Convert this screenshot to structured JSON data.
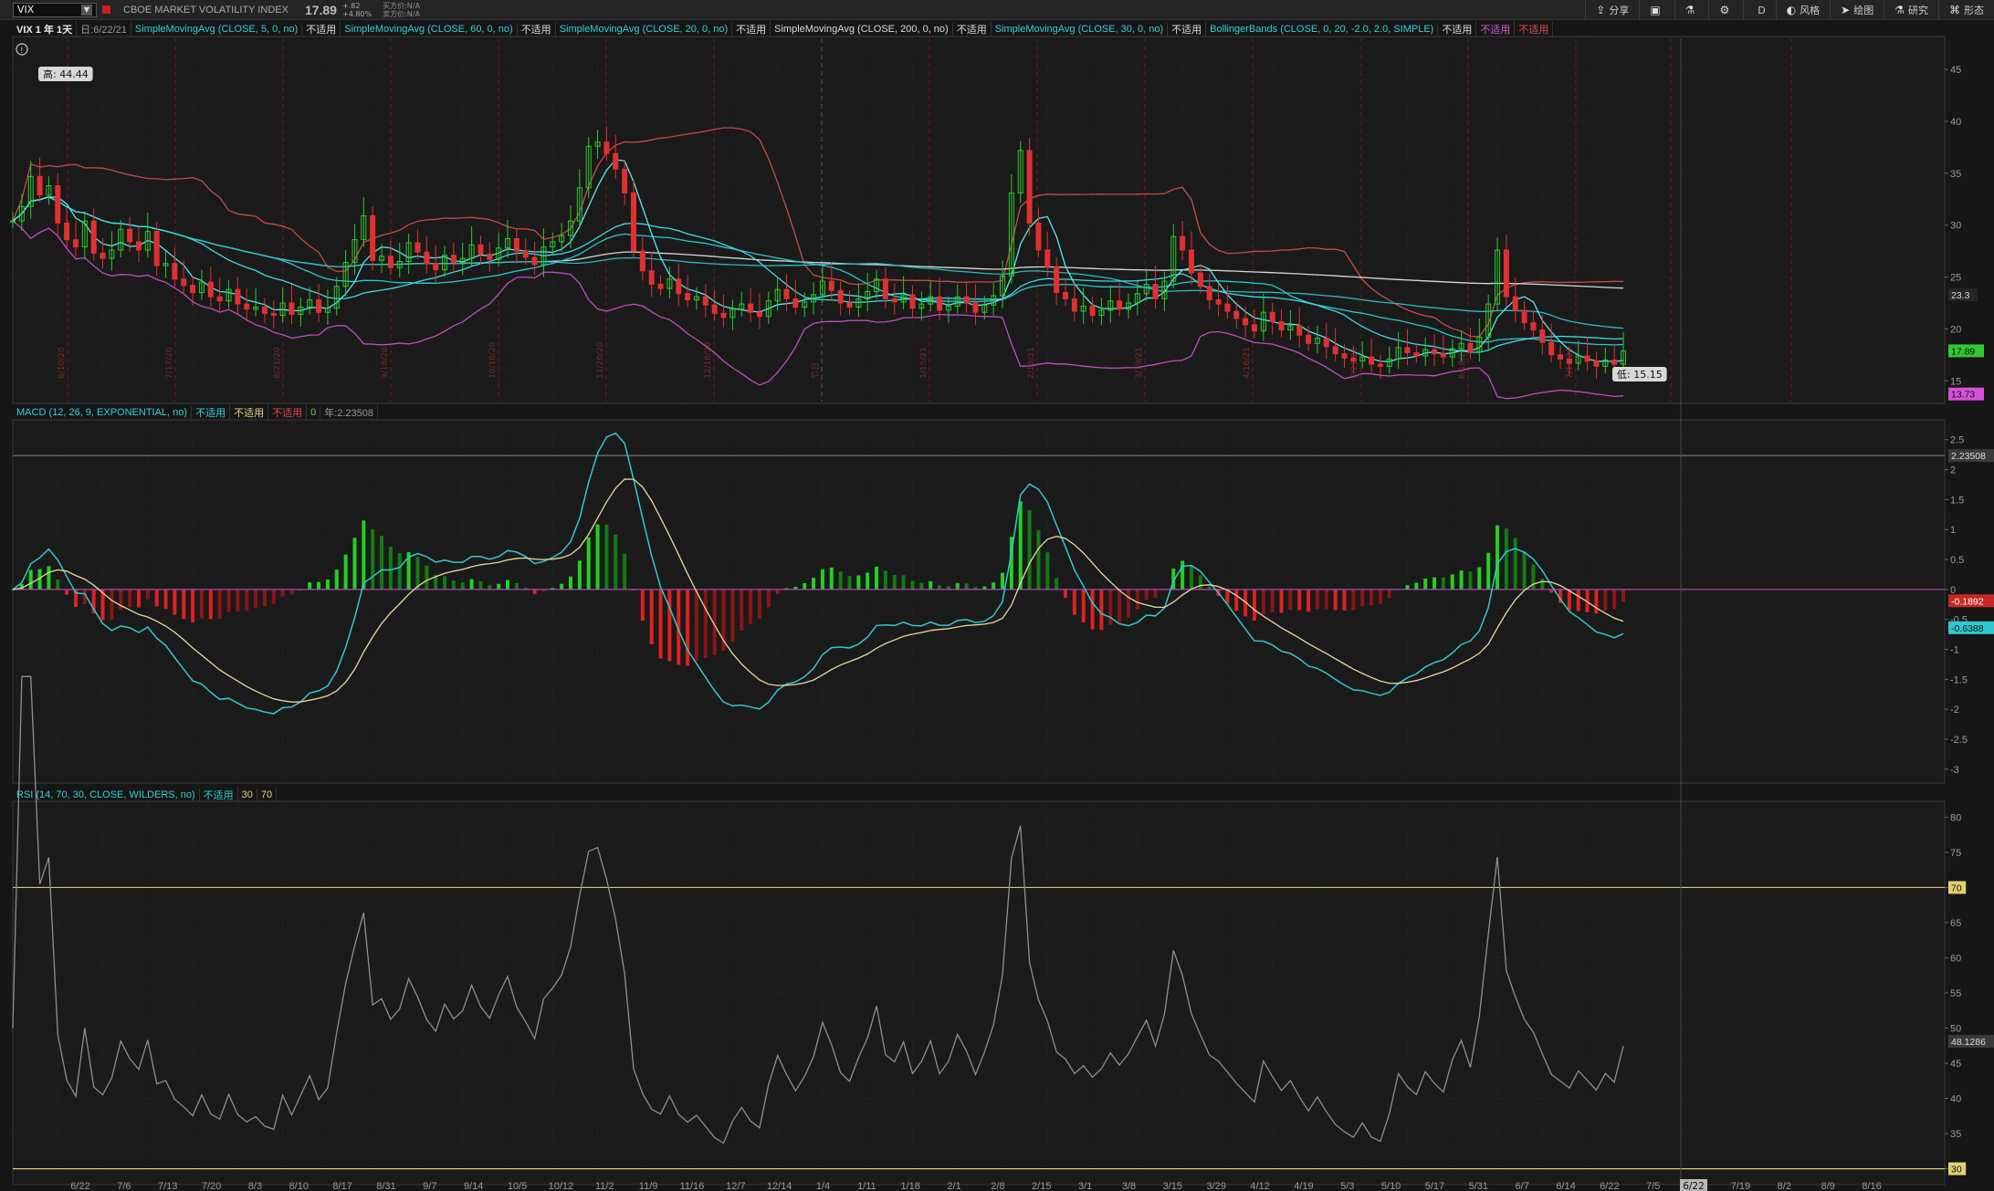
{
  "toolbar": {
    "symbol": "VIX",
    "instrument_title": "CBOE MARKET VOLATILITY INDEX",
    "last_price": "17.89",
    "change_abs": "+.82",
    "change_pct": "+4.80%",
    "bid_label": "买方价:N/A",
    "ask_label": "卖方价:N/A",
    "tools": [
      {
        "icon": "share-icon",
        "label": "分享"
      },
      {
        "icon": "layout-icon",
        "label": ""
      },
      {
        "icon": "flask-icon",
        "label": ""
      },
      {
        "icon": "gear-icon",
        "label": ""
      },
      {
        "icon": "d-label",
        "label": "D"
      },
      {
        "icon": "style-icon",
        "label": "风格"
      },
      {
        "icon": "cursor-icon",
        "label": "绘图"
      },
      {
        "icon": "study-icon",
        "label": "研究"
      },
      {
        "icon": "pattern-icon",
        "label": "形态"
      }
    ]
  },
  "price_panel": {
    "header_items": [
      {
        "text": "VIX 1 年 1天",
        "cls": "c-w"
      },
      {
        "text": "日:6/22/21",
        "cls": "c-g"
      },
      {
        "text": "SimpleMovingAvg (CLOSE, 5, 0, no)",
        "cls": "c-cy"
      },
      {
        "text": "不适用",
        "cls": "c-wh"
      },
      {
        "text": "SimpleMovingAvg (CLOSE, 60, 0, no)",
        "cls": "c-cy"
      },
      {
        "text": "不适用",
        "cls": "c-wh"
      },
      {
        "text": "SimpleMovingAvg (CLOSE, 20, 0, no)",
        "cls": "c-cy"
      },
      {
        "text": "不适用",
        "cls": "c-wh"
      },
      {
        "text": "SimpleMovingAvg (CLOSE, 200, 0, no)",
        "cls": "c-wh"
      },
      {
        "text": "不适用",
        "cls": "c-wh"
      },
      {
        "text": "SimpleMovingAvg (CLOSE, 30, 0, no)",
        "cls": "c-cy"
      },
      {
        "text": "不适用",
        "cls": "c-wh"
      },
      {
        "text": "BollingerBands (CLOSE, 0, 20, -2.0, 2.0, SIMPLE)",
        "cls": "c-cy"
      },
      {
        "text": "不适用",
        "cls": "c-wh"
      },
      {
        "text": "不适用",
        "cls": "c-mg"
      },
      {
        "text": "不适用",
        "cls": "c-r"
      }
    ],
    "high_label": "高: 44.44",
    "low_label": "低: 15.15",
    "axis_ticks": [
      "45",
      "40",
      "35",
      "30",
      "25",
      "20",
      "15"
    ],
    "badges": [
      {
        "text": "23.3",
        "color": "#dcdcdc",
        "bg": "#262626"
      },
      {
        "text": "17.89",
        "color": "#101010",
        "bg": "#32c832"
      },
      {
        "text": "13.73",
        "color": "#101010",
        "bg": "#d850d8"
      }
    ],
    "event_labels": [
      "6/10/20",
      "7/17/20",
      "8/21/20",
      "9/18/20",
      "10/16/20",
      "11/20/20",
      "12/18/20",
      "节日",
      "1/15/21",
      "2/19/21",
      "3/19/21",
      "4/16/21",
      "5/21/21",
      "6/18/21",
      "7/16/21"
    ]
  },
  "macd_panel": {
    "header_items": [
      {
        "text": "MACD (12, 26, 9, EXPONENTIAL, no)",
        "cls": "c-cy"
      },
      {
        "text": "不适用",
        "cls": "c-cy"
      },
      {
        "text": "不适用",
        "cls": "c-y"
      },
      {
        "text": "不适用",
        "cls": "c-r"
      },
      {
        "text": "0",
        "cls": "c-gr"
      },
      {
        "text": "年:2.23508",
        "cls": "c-g"
      }
    ],
    "axis_ticks": [
      "2.5",
      "2",
      "1.5",
      "1",
      "0.5",
      "0",
      "-0.5",
      "-1",
      "-1.5",
      "-2",
      "-2.5",
      "-3"
    ],
    "badges": [
      {
        "text": "2.23508",
        "color": "#dcdcdc",
        "bg": "#3a3a3a"
      },
      {
        "text": "-0.1892",
        "color": "#ffffff",
        "bg": "#c82828"
      },
      {
        "text": "-0.6388",
        "color": "#101010",
        "bg": "#30c8d0"
      }
    ]
  },
  "rsi_panel": {
    "header_items": [
      {
        "text": "RSI (14, 70, 30, CLOSE, WILDERS, no)",
        "cls": "c-cy"
      },
      {
        "text": "不适用",
        "cls": "c-cy"
      },
      {
        "text": "30",
        "cls": "c-y"
      },
      {
        "text": "70",
        "cls": "c-y"
      }
    ],
    "axis_ticks": [
      "80",
      "75",
      "70",
      "65",
      "60",
      "55",
      "50",
      "45",
      "40",
      "35",
      "30"
    ],
    "badges": [
      {
        "text": "70",
        "color": "#101010",
        "bg": "#e0d070"
      },
      {
        "text": "48.1286",
        "color": "#dcdcdc",
        "bg": "#3a3a3a"
      },
      {
        "text": "30",
        "color": "#101010",
        "bg": "#e0d070"
      }
    ]
  },
  "x_axis": {
    "labels": [
      "6/22",
      "7/6",
      "7/13",
      "7/20",
      "8/3",
      "8/10",
      "8/17",
      "8/31",
      "9/7",
      "9/14",
      "10/5",
      "10/12",
      "11/2",
      "11/9",
      "11/16",
      "12/7",
      "12/14",
      "1/4",
      "1/11",
      "1/18",
      "2/1",
      "2/8",
      "2/15",
      "3/1",
      "3/8",
      "3/15",
      "3/29",
      "4/12",
      "4/19",
      "5/3",
      "5/10",
      "5/17",
      "5/31",
      "6/7",
      "6/14",
      "6/22",
      "7/5",
      "7/12",
      "7/19",
      "8/2",
      "8/9",
      "8/16"
    ],
    "current_label": "6/22"
  },
  "chart_data": {
    "type": "line",
    "symbol": "VIX",
    "panels": [
      "price",
      "MACD",
      "RSI"
    ],
    "price_ylim": [
      13,
      48
    ],
    "macd_ylim": [
      -3.2,
      2.8
    ],
    "rsi_ylim": [
      28,
      82
    ],
    "rsi_levels": [
      70,
      30
    ],
    "close_series": [
      30.4,
      31.8,
      34.7,
      32.9,
      33.8,
      30.2,
      28.6,
      27.9,
      30.4,
      27.3,
      26.8,
      27.6,
      29.6,
      28.4,
      27.6,
      29.4,
      26.1,
      26.3,
      24.8,
      24.2,
      23.5,
      24.5,
      23.1,
      22.7,
      23.8,
      22.4,
      21.9,
      22.1,
      21.5,
      21.3,
      22.5,
      21.4,
      22.1,
      22.8,
      21.6,
      22.0,
      24.1,
      26.4,
      28.6,
      30.9,
      26.6,
      27.0,
      25.9,
      26.5,
      28.3,
      27.4,
      26.3,
      25.7,
      27.1,
      26.4,
      26.8,
      28.1,
      27.2,
      26.7,
      27.8,
      28.7,
      27.5,
      26.9,
      26.2,
      27.9,
      28.4,
      29.0,
      30.4,
      33.6,
      37.6,
      38.0,
      36.9,
      35.4,
      33.1,
      27.5,
      25.6,
      24.3,
      23.9,
      24.8,
      23.4,
      22.8,
      23.1,
      22.3,
      21.5,
      21.1,
      21.9,
      22.4,
      21.6,
      21.2,
      22.7,
      23.8,
      22.9,
      22.1,
      22.6,
      23.3,
      24.6,
      23.7,
      22.5,
      22.1,
      22.9,
      23.6,
      24.8,
      22.9,
      22.6,
      23.3,
      22.0,
      22.4,
      23.1,
      21.8,
      22.2,
      23.1,
      22.5,
      21.6,
      22.3,
      23.2,
      25.1,
      33.1,
      37.2,
      30.2,
      27.6,
      26.0,
      23.5,
      22.9,
      21.7,
      22.2,
      21.3,
      21.8,
      22.7,
      21.9,
      22.5,
      23.4,
      24.3,
      22.9,
      24.6,
      28.9,
      27.6,
      25.4,
      24.1,
      22.8,
      22.4,
      21.7,
      21.0,
      20.4,
      19.8,
      21.6,
      20.7,
      19.9,
      20.3,
      19.4,
      18.6,
      19.1,
      18.3,
      17.6,
      17.2,
      16.9,
      17.3,
      16.6,
      16.4,
      17.1,
      18.2,
      17.7,
      17.4,
      18.0,
      17.6,
      17.3,
      18.1,
      18.6,
      17.8,
      19.2,
      22.4,
      27.6,
      23.1,
      21.8,
      20.6,
      19.9,
      18.7,
      17.5,
      17.1,
      16.7,
      17.4,
      16.9,
      16.4,
      17.0,
      16.6,
      17.89
    ],
    "sma_periods": [
      5,
      20,
      30,
      60,
      200
    ],
    "bollinger": {
      "length": 20,
      "num_dev_dn": -2.0,
      "num_dev_up": 2.0
    },
    "macd": {
      "fast": 12,
      "slow": 26,
      "signal": 9
    },
    "rsi": {
      "length": 14
    }
  }
}
